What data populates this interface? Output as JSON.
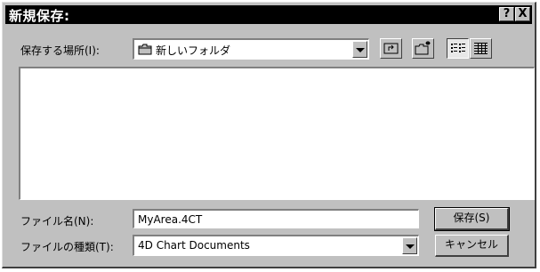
{
  "window": {
    "title": "新規保存:",
    "help_label": "?",
    "close_label": "X"
  },
  "location": {
    "label": "保存する場所(I):",
    "value": "新しいフォルダ"
  },
  "toolbar": {
    "up_folder_icon": "up-one-level-icon",
    "new_folder_icon": "new-folder-icon",
    "list_view_icon": "list-view-icon",
    "details_view_icon": "details-view-icon"
  },
  "file_list": {
    "items": []
  },
  "filename": {
    "label": "ファイル名(N):",
    "value": "MyArea.4CT"
  },
  "filetype": {
    "label": "ファイルの種類(T):",
    "value": "4D Chart Documents"
  },
  "buttons": {
    "save_label": "保存(S)",
    "cancel_label": "キャンセル"
  },
  "colors": {
    "titlebar": "#000000",
    "face": "#c0c0c0"
  }
}
